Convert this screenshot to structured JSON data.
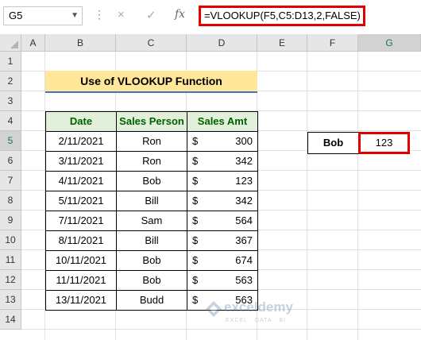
{
  "formula_bar": {
    "name_box": "G5",
    "formula": "=VLOOKUP(F5,C5:D13,2,FALSE)",
    "cancel_icon": "×",
    "enter_icon": "✓",
    "fx_label": "fx"
  },
  "columns": [
    "A",
    "B",
    "C",
    "D",
    "E",
    "F",
    "G"
  ],
  "rows": [
    "1",
    "2",
    "3",
    "4",
    "5",
    "6",
    "7",
    "8",
    "9",
    "10",
    "11",
    "12",
    "13",
    "14"
  ],
  "title": "Use of VLOOKUP Function",
  "table": {
    "headers": [
      "Date",
      "Sales Person",
      "Sales Amt"
    ],
    "currency": "$",
    "rows": [
      {
        "date": "2/11/2021",
        "person": "Ron",
        "amt": "300"
      },
      {
        "date": "3/11/2021",
        "person": "Ron",
        "amt": "342"
      },
      {
        "date": "4/11/2021",
        "person": "Bob",
        "amt": "123"
      },
      {
        "date": "5/11/2021",
        "person": "Bill",
        "amt": "342"
      },
      {
        "date": "7/11/2021",
        "person": "Sam",
        "amt": "564"
      },
      {
        "date": "8/11/2021",
        "person": "Bill",
        "amt": "367"
      },
      {
        "date": "10/11/2021",
        "person": "Bob",
        "amt": "674"
      },
      {
        "date": "11/11/2021",
        "person": "Bob",
        "amt": "563"
      },
      {
        "date": "13/11/2021",
        "person": "Budd",
        "amt": "563"
      }
    ]
  },
  "lookup": {
    "label": "Bob",
    "result": "123"
  },
  "watermark": {
    "name": "exceldemy",
    "tagline": "EXCEL · DATA · BI"
  },
  "colors": {
    "highlight": "#e00000",
    "title_bg": "#ffe699",
    "header_bg": "#e2efda",
    "header_text": "#006100"
  }
}
